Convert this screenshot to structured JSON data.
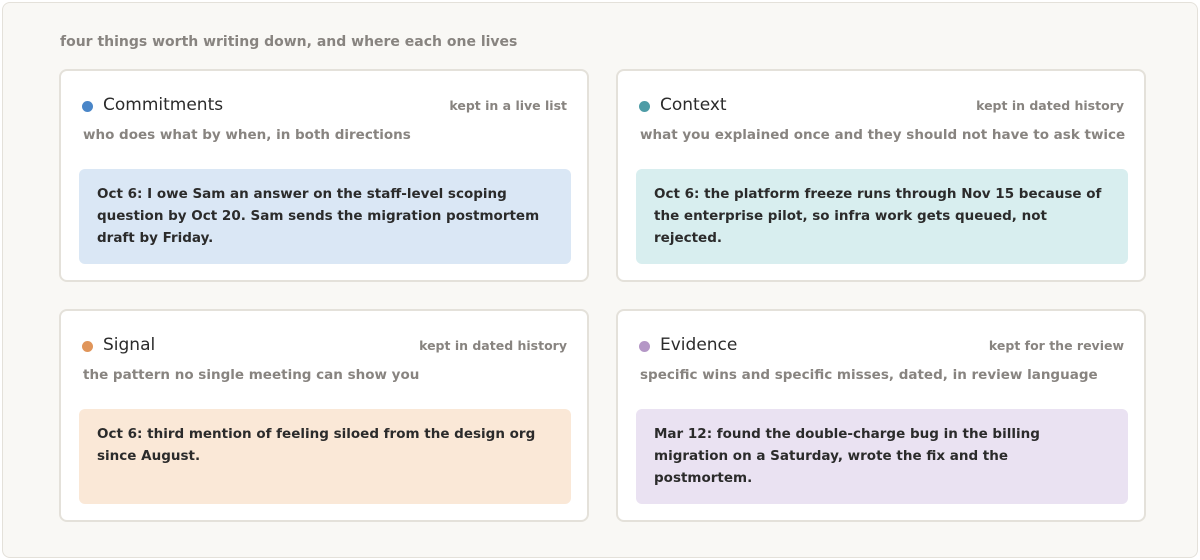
{
  "heading": "four things worth writing down, and where each one lives",
  "cards": [
    {
      "title": "Commitments",
      "where": "kept in a live list",
      "description": "who does what by when, in both directions",
      "example": "Oct 6: I owe Sam an answer on the staff-level scoping question by Oct 20. Sam sends the migration postmortem draft by Friday.",
      "dot_color": "#4a86c8"
    },
    {
      "title": "Context",
      "where": "kept in dated history",
      "description": "what you explained once and they should not have to ask twice",
      "example": "Oct 6: the platform freeze runs through Nov 15 because of the enterprise pilot, so infra work gets queued, not rejected.",
      "dot_color": "#4e9ca6"
    },
    {
      "title": "Signal",
      "where": "kept in dated history",
      "description": "the pattern no single meeting can show you",
      "example": "Oct 6: third mention of feeling siloed from the design org since August.",
      "dot_color": "#e0955a"
    },
    {
      "title": "Evidence",
      "where": "kept for the review",
      "description": "specific wins and specific misses, dated, in review language",
      "example": "Mar 12: found the double-charge bug in the billing migration on a Saturday, wrote the fix and the postmortem.",
      "dot_color": "#b497c6"
    }
  ]
}
